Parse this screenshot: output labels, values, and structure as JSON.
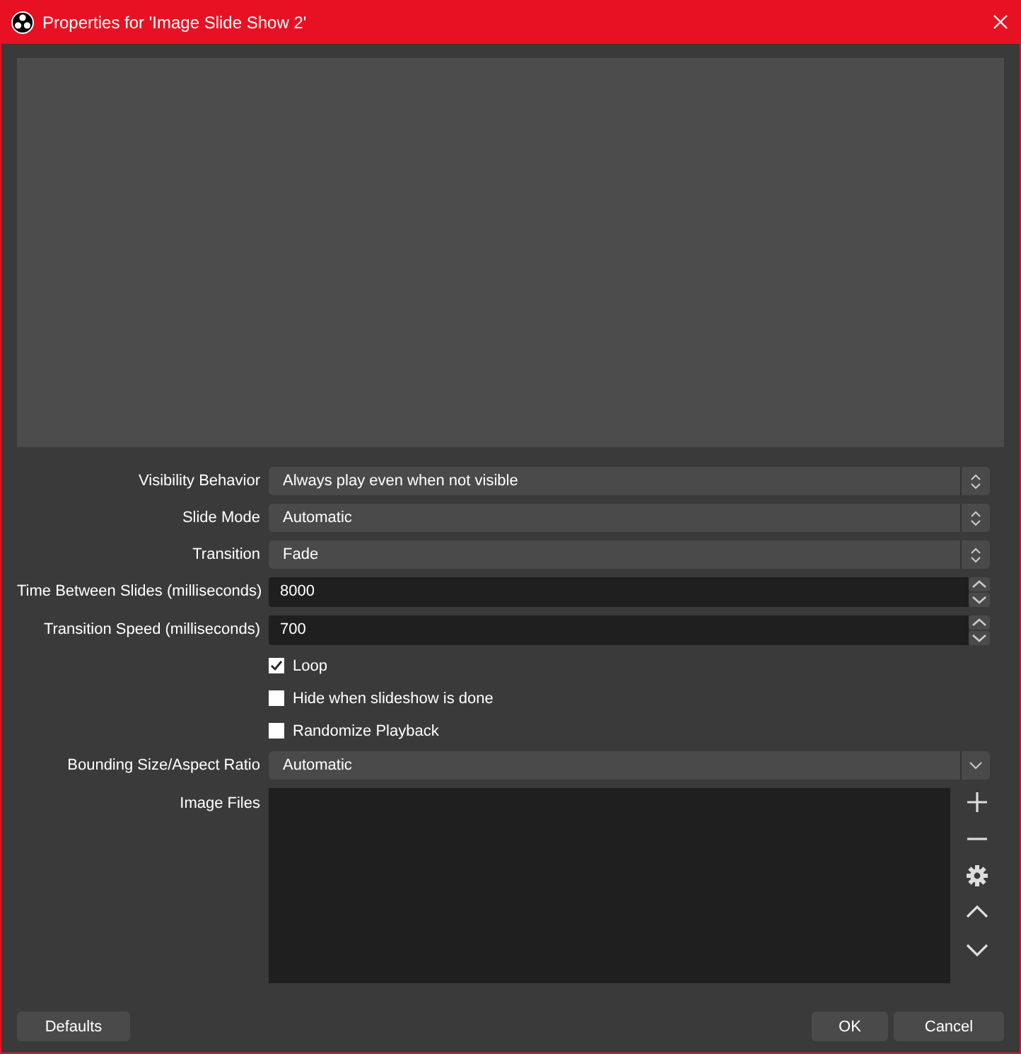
{
  "window": {
    "title": "Properties for 'Image Slide Show 2'"
  },
  "properties": [
    {
      "kind": "select",
      "label": "Visibility Behavior",
      "value": "Always play even when not visible"
    },
    {
      "kind": "select",
      "label": "Slide Mode",
      "value": "Automatic"
    },
    {
      "kind": "select",
      "label": "Transition",
      "value": "Fade"
    },
    {
      "kind": "spin",
      "label": "Time Between Slides (milliseconds)",
      "value": "8000"
    },
    {
      "kind": "spin",
      "label": "Transition Speed (milliseconds)",
      "value": "700"
    },
    {
      "kind": "check",
      "label": "Loop",
      "checked": true
    },
    {
      "kind": "check",
      "label": "Hide when slideshow is done",
      "checked": false
    },
    {
      "kind": "check",
      "label": "Randomize Playback",
      "checked": false
    },
    {
      "kind": "combo",
      "label": "Bounding Size/Aspect Ratio",
      "value": "Automatic"
    },
    {
      "kind": "filelist",
      "label": "Image Files"
    }
  ],
  "buttons": {
    "defaults": "Defaults",
    "ok": "OK",
    "cancel": "Cancel"
  }
}
